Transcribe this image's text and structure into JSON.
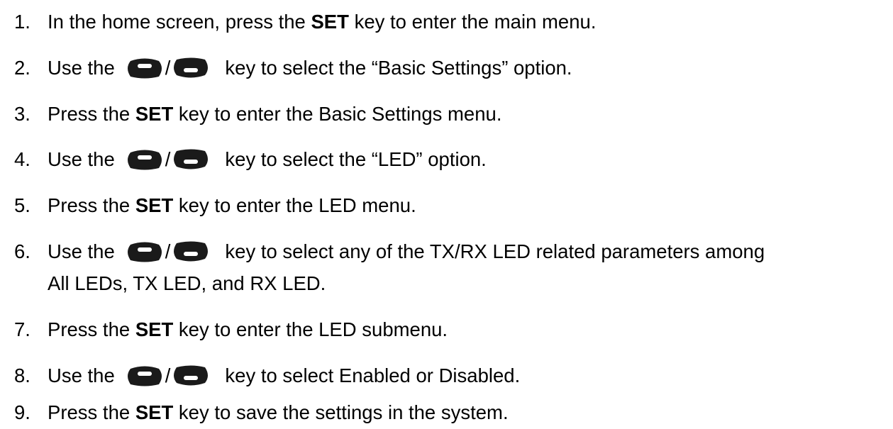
{
  "steps": [
    {
      "num": "1.",
      "t1": "In the home screen, press the ",
      "bold": "SET",
      "t2": " key to enter the main menu."
    },
    {
      "num": "2.",
      "pre": "Use the",
      "slash": "/",
      "post": "key to select the “Basic Settings” option."
    },
    {
      "num": "3.",
      "t1": "Press the ",
      "bold": "SET",
      "t2": " key to enter the Basic Settings menu."
    },
    {
      "num": "4.",
      "pre": "Use the",
      "slash": "/",
      "post": "key to select the “LED” option."
    },
    {
      "num": "5.",
      "t1": "Press the ",
      "bold": "SET",
      "t2": " key to enter the LED menu."
    },
    {
      "num": "6.",
      "pre": "Use the",
      "slash": "/",
      "post": "key to select any of the TX/RX LED related parameters among",
      "cont": "All LEDs, TX LED, and RX LED."
    },
    {
      "num": "7.",
      "t1": "Press the ",
      "bold": "SET",
      "t2": " key to enter the LED submenu."
    },
    {
      "num": "8.",
      "pre": "Use the",
      "slash": "/",
      "post": "key to select Enabled or Disabled."
    },
    {
      "num": "9.",
      "t1": "Press the ",
      "bold": "SET",
      "t2": " key to save the settings in the system."
    }
  ],
  "icons": {
    "up_key": "up-key-icon",
    "down_key": "down-key-icon"
  },
  "colors": {
    "text": "#000000",
    "key_body": "#1a1a1a",
    "key_mark": "#ffffff"
  }
}
